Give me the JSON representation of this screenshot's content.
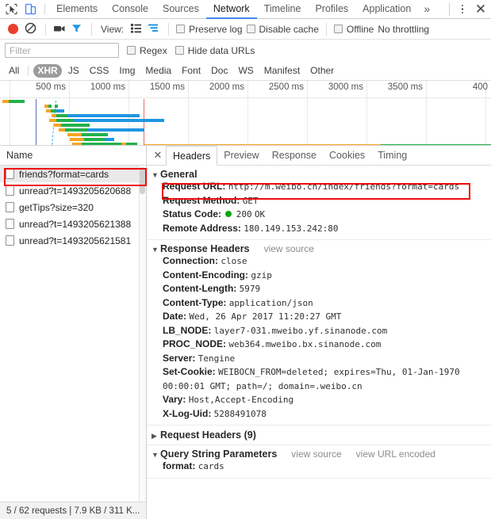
{
  "devtools": {
    "icons": {
      "inspect": "inspect-cursor-icon",
      "device": "device-toolbar-icon"
    },
    "tabs": [
      {
        "label": "Elements",
        "active": false
      },
      {
        "label": "Console",
        "active": false
      },
      {
        "label": "Sources",
        "active": false
      },
      {
        "label": "Network",
        "active": true
      },
      {
        "label": "Timeline",
        "active": false
      },
      {
        "label": "Profiles",
        "active": false
      },
      {
        "label": "Application",
        "active": false
      }
    ],
    "more_label": "»",
    "close_label": "✕"
  },
  "network_toolbar": {
    "record_title": "record-button",
    "clear_title": "clear-button",
    "camera_title": "screenshot-button",
    "filter_title": "filter-button",
    "view_label": "View:",
    "preserve_log_label": "Preserve log",
    "disable_cache_label": "Disable cache",
    "offline_label": "Offline",
    "throttling_value": "No throttling"
  },
  "filter_bar": {
    "placeholder": "Filter",
    "value": "",
    "regex_label": "Regex",
    "hide_data_urls_label": "Hide data URLs"
  },
  "type_filters": {
    "all_label": "All",
    "items": [
      {
        "label": "XHR",
        "selected": true
      },
      {
        "label": "JS",
        "selected": false
      },
      {
        "label": "CSS",
        "selected": false
      },
      {
        "label": "Img",
        "selected": false
      },
      {
        "label": "Media",
        "selected": false
      },
      {
        "label": "Font",
        "selected": false
      },
      {
        "label": "Doc",
        "selected": false
      },
      {
        "label": "WS",
        "selected": false
      },
      {
        "label": "Manifest",
        "selected": false
      },
      {
        "label": "Other",
        "selected": false
      }
    ]
  },
  "overview": {
    "ticks": [
      "500 ms",
      "1000 ms",
      "1500 ms",
      "2000 ms",
      "2500 ms",
      "3000 ms",
      "3500 ms",
      "400"
    ]
  },
  "requests": {
    "column_header": "Name",
    "rows": [
      {
        "name": "friends?format=cards",
        "selected": true,
        "highlighted": true
      },
      {
        "name": "unread?t=1493205620688",
        "selected": false,
        "highlighted": false
      },
      {
        "name": "getTips?size=320",
        "selected": false,
        "highlighted": false
      },
      {
        "name": "unread?t=1493205621388",
        "selected": false,
        "highlighted": false
      },
      {
        "name": "unread?t=1493205621581",
        "selected": false,
        "highlighted": false
      }
    ]
  },
  "status_bar": {
    "text": "5 / 62 requests  |  7.9 KB / 311 K..."
  },
  "details": {
    "close_label": "✕",
    "tabs": [
      {
        "label": "Headers",
        "active": true
      },
      {
        "label": "Preview",
        "active": false
      },
      {
        "label": "Response",
        "active": false
      },
      {
        "label": "Cookies",
        "active": false
      },
      {
        "label": "Timing",
        "active": false
      }
    ],
    "general": {
      "title": "General",
      "request_url_key": "Request URL:",
      "request_url_value": "http://m.weibo.cn/index/friends?format=cards",
      "request_method_key": "Request Method:",
      "request_method_value": "GET",
      "status_code_key": "Status Code:",
      "status_code_value": "200",
      "status_code_text": "OK",
      "remote_address_key": "Remote Address:",
      "remote_address_value": "180.149.153.242:80"
    },
    "response_headers": {
      "title": "Response Headers",
      "view_source_label": "view source",
      "items": [
        {
          "key": "Connection:",
          "value": "close"
        },
        {
          "key": "Content-Encoding:",
          "value": "gzip"
        },
        {
          "key": "Content-Length:",
          "value": "5979"
        },
        {
          "key": "Content-Type:",
          "value": "application/json"
        },
        {
          "key": "Date:",
          "value": "Wed, 26 Apr 2017 11:20:27 GMT"
        },
        {
          "key": "LB_NODE:",
          "value": "layer7-031.mweibo.yf.sinanode.com"
        },
        {
          "key": "PROC_NODE:",
          "value": "web364.mweibo.bx.sinanode.com"
        },
        {
          "key": "Server:",
          "value": "Tengine"
        },
        {
          "key": "Set-Cookie:",
          "value": "WEIBOCN_FROM=deleted; expires=Thu, 01-Jan-1970 00:00:01 GMT; path=/; domain=.weibo.cn"
        },
        {
          "key": "Vary:",
          "value": "Host,Accept-Encoding"
        },
        {
          "key": "X-Log-Uid:",
          "value": "5288491078"
        }
      ]
    },
    "request_headers": {
      "title": "Request Headers (9)"
    },
    "query_string": {
      "title": "Query String Parameters",
      "view_source_label": "view source",
      "view_url_encoded_label": "view URL encoded",
      "items": [
        {
          "key": "format:",
          "value": "cards"
        }
      ]
    }
  },
  "colors": {
    "accent": "#4285f4",
    "record": "#e8402a",
    "annotation": "#ee0b0b",
    "status_ok": "#0aa80a",
    "bar_blue": "#2196e3",
    "bar_green": "#22b14c",
    "bar_orange": "#f5a623"
  }
}
